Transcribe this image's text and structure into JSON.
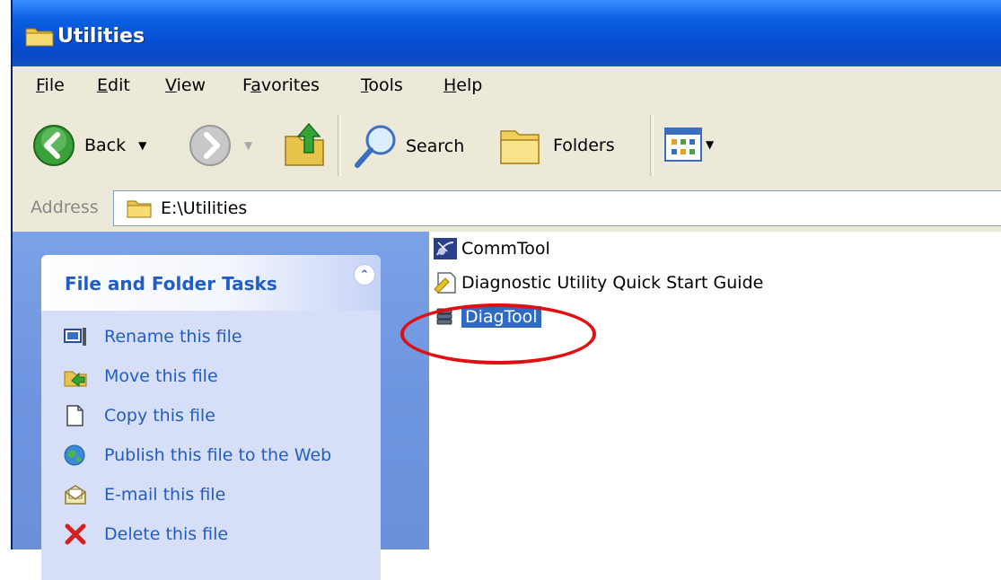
{
  "window": {
    "title": "Utilities"
  },
  "menu": {
    "items": [
      {
        "label_u": "F",
        "label_rest": "ile"
      },
      {
        "label_u": "E",
        "label_rest": "dit"
      },
      {
        "label_u": "V",
        "label_rest": "iew"
      },
      {
        "label_pre": "F",
        "label_u": "a",
        "label_rest": "vorites"
      },
      {
        "label_u": "T",
        "label_rest": "ools"
      },
      {
        "label_u": "H",
        "label_rest": "elp"
      }
    ]
  },
  "toolbar": {
    "back_label": "Back",
    "search_label": "Search",
    "folders_label": "Folders"
  },
  "address": {
    "label": "Address",
    "value": "E:\\Utilities"
  },
  "tasks": {
    "header": "File and Folder Tasks",
    "items": [
      {
        "label": "Rename this file",
        "icon": "rename-icon"
      },
      {
        "label": "Move this file",
        "icon": "move-icon"
      },
      {
        "label": "Copy this file",
        "icon": "copy-icon"
      },
      {
        "label": "Publish this file to the Web",
        "icon": "publish-web-icon"
      },
      {
        "label": "E-mail this file",
        "icon": "email-icon"
      },
      {
        "label": "Delete this file",
        "icon": "delete-icon"
      }
    ]
  },
  "files": {
    "items": [
      {
        "name": "CommTool",
        "icon": "satellite-app-icon",
        "selected": false
      },
      {
        "name": "Diagnostic Utility Quick Start Guide",
        "icon": "document-icon",
        "selected": false
      },
      {
        "name": "DiagTool",
        "icon": "app-stack-icon",
        "selected": true
      }
    ]
  },
  "colors": {
    "titlebar": "#0550d6",
    "chrome": "#ece9d8",
    "task_link": "#215dc6",
    "selection": "#316ac5",
    "annotation": "#e01010"
  }
}
